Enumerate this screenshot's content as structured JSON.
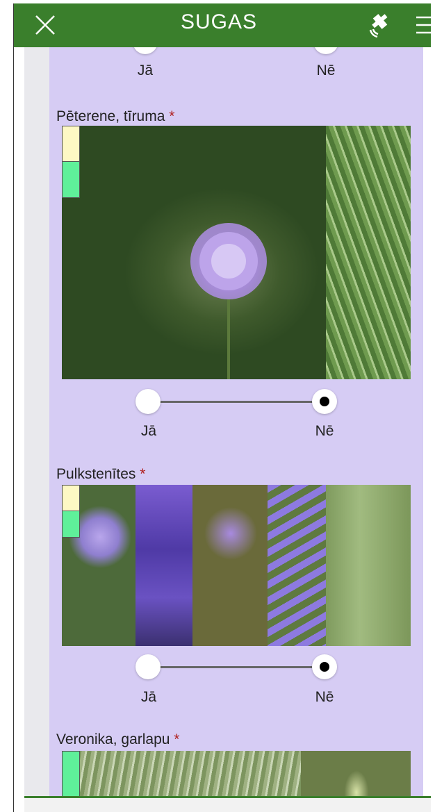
{
  "header": {
    "title": "SUGAS",
    "close_icon": "close-icon",
    "gps_icon": "satellite-icon",
    "menu_icon": "hamburger-menu-icon",
    "color": "#3a7f2c"
  },
  "background_color": "#d6ccf4",
  "top_toggle": {
    "yes_label": "Jā",
    "no_label": "Nē"
  },
  "species": [
    {
      "name": "Pēterene, tīruma",
      "required_mark": "*",
      "yes_label": "Jā",
      "no_label": "Nē",
      "selected": "Nē"
    },
    {
      "name": "Pulkstenītes",
      "required_mark": "*",
      "yes_label": "Jā",
      "no_label": "Nē",
      "selected": "Nē"
    },
    {
      "name": "Veronika, garlapu",
      "required_mark": "*"
    }
  ]
}
